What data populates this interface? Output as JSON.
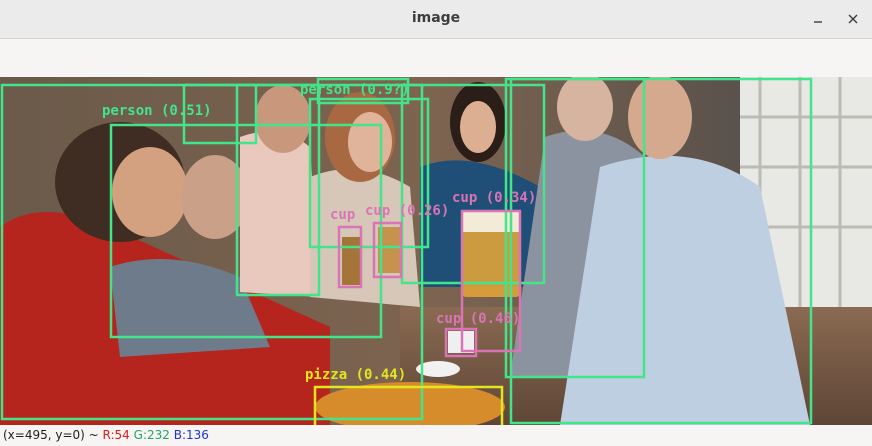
{
  "window": {
    "title": "image",
    "minimize_icon": "minimize-icon",
    "close_icon": "close-icon"
  },
  "detections": [
    {
      "label": "person (0.51)",
      "color": "#44e48a"
    },
    {
      "label": "person (0.9?)",
      "color": "#44e48a"
    },
    {
      "label": "cup (0.26)",
      "color": "#d975b4"
    },
    {
      "label": "cup (0.34)",
      "color": "#d975b4"
    },
    {
      "label": "cup (0.46)",
      "color": "#d975b4"
    },
    {
      "label": "pizza (0.44)",
      "color": "#e5e51e"
    }
  ],
  "status": {
    "prefix": "(x=495, y=0) ~ ",
    "r": "R:54",
    "g": "G:232",
    "b": "B:136"
  }
}
